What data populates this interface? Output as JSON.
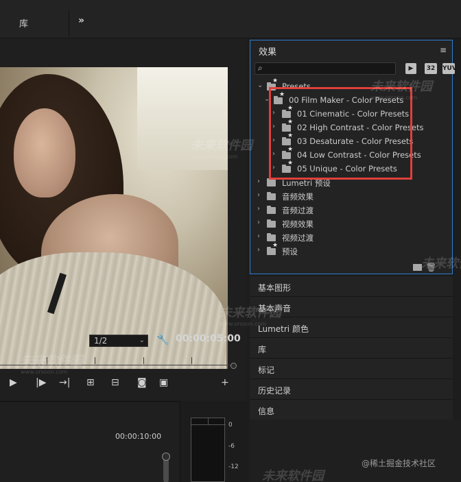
{
  "top_tabs": {
    "library": "库",
    "more": "»"
  },
  "monitor": {
    "zoom": "1/2",
    "timecode": "00:00:05:00"
  },
  "timeline": {
    "timestamp": "00:00:10:00",
    "meter_labels": [
      "0",
      "-6",
      "-12"
    ]
  },
  "effects_panel": {
    "title": "效果",
    "menu_icon": "≡",
    "search_placeholder": "",
    "filter_buttons": [
      "32",
      "YUV"
    ],
    "tree": [
      {
        "label": "Presets",
        "level": 0,
        "expanded": true,
        "star": true
      },
      {
        "label": "00 Film Maker - Color Presets",
        "level": 1,
        "expanded": true,
        "star": true
      },
      {
        "label": "01 Cinematic - Color Presets",
        "level": 2,
        "expanded": false,
        "star": true
      },
      {
        "label": "02 High Contrast - Color Presets",
        "level": 2,
        "expanded": false,
        "star": true
      },
      {
        "label": "03 Desaturate - Color Presets",
        "level": 2,
        "expanded": false,
        "star": true
      },
      {
        "label": "04 Low Contrast - Color Presets",
        "level": 2,
        "expanded": false,
        "star": true
      },
      {
        "label": "05 Unique - Color Presets",
        "level": 2,
        "expanded": false,
        "star": true
      },
      {
        "label": "Lumetri 预设",
        "level": 0,
        "expanded": false,
        "star": false
      },
      {
        "label": "音频效果",
        "level": 0,
        "expanded": false,
        "star": false
      },
      {
        "label": "音频过渡",
        "level": 0,
        "expanded": false,
        "star": false
      },
      {
        "label": "视频效果",
        "level": 0,
        "expanded": false,
        "star": false
      },
      {
        "label": "视频过渡",
        "level": 0,
        "expanded": false,
        "star": false
      },
      {
        "label": "预设",
        "level": 0,
        "expanded": false,
        "star": true
      }
    ]
  },
  "side_panels": [
    "基本图形",
    "基本声音",
    "Lumetri 颜色",
    "库",
    "标记",
    "历史记录",
    "信息"
  ],
  "credit": "@稀土掘金技术社区",
  "watermark": {
    "brand": "未来软件园",
    "url": "www.orsoon.com"
  },
  "colors": {
    "highlight": "#e0403a",
    "panel_border": "#2d7fd4"
  }
}
